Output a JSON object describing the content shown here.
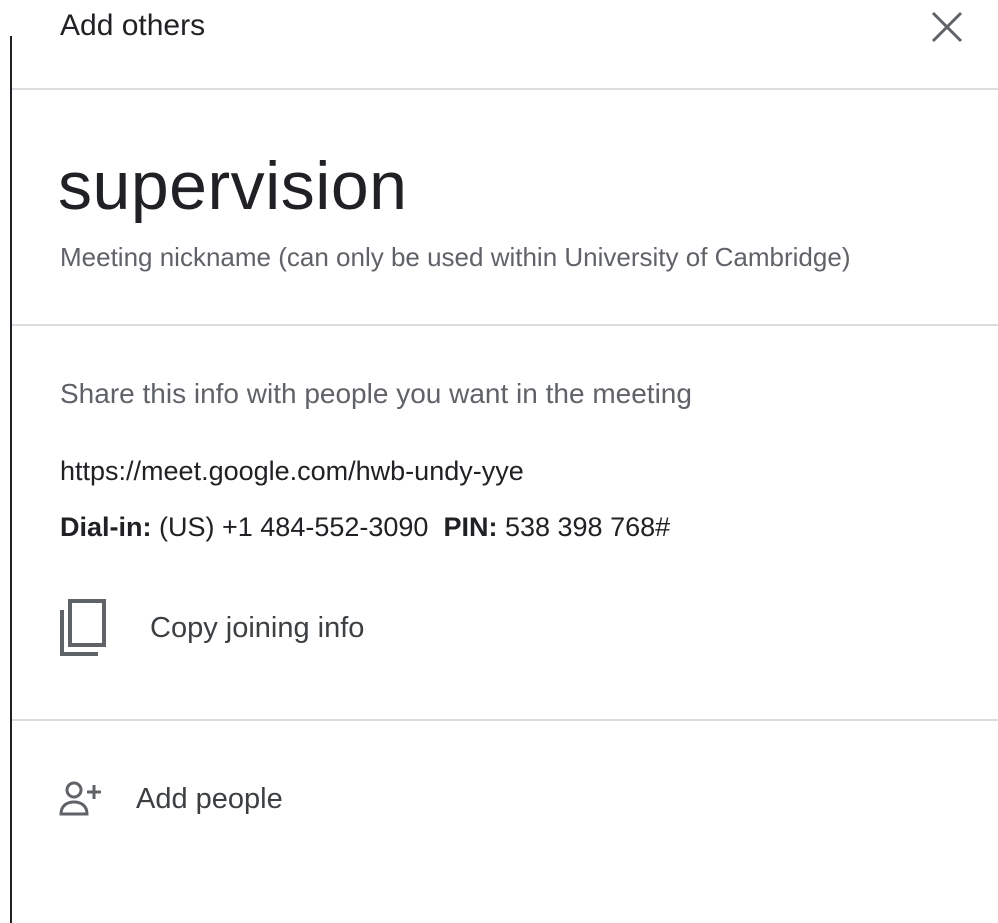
{
  "dialog": {
    "title": "Add others",
    "close_icon": "close-icon"
  },
  "meeting": {
    "nickname": "supervision",
    "nickname_caption": "Meeting nickname (can only be used within University of Cambridge)"
  },
  "share": {
    "caption": "Share this info with people you want in the meeting",
    "url": "https://meet.google.com/hwb-undy-yye",
    "dial_in_label": "Dial-in:",
    "dial_in_value": "(US) +1 484-552-3090",
    "pin_label": "PIN:",
    "pin_value": "538 398 768#"
  },
  "actions": {
    "copy_label": "Copy joining info",
    "copy_icon": "copy-icon",
    "add_people_label": "Add people",
    "add_people_icon": "person-add-icon"
  },
  "colors": {
    "text_primary": "#202124",
    "text_secondary": "#5f6368",
    "divider": "#dadce0"
  }
}
